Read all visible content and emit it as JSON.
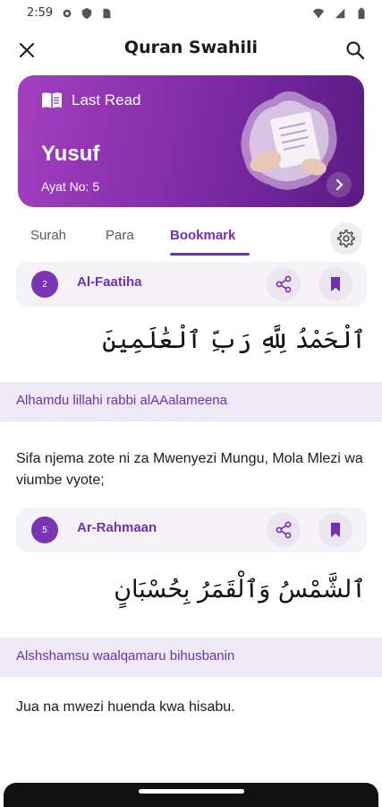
{
  "status_bar": {
    "time": "2:59"
  },
  "app_bar": {
    "title": "Quran Swahili"
  },
  "last_read": {
    "label": "Last Read",
    "surah": "Yusuf",
    "ayat": "Ayat No: 5"
  },
  "tabs": [
    {
      "label": "Surah",
      "active": false
    },
    {
      "label": "Para",
      "active": false
    },
    {
      "label": "Bookmark",
      "active": true
    }
  ],
  "bookmarks": [
    {
      "number": "2",
      "surah": "Al-Faatiha",
      "arabic": "ٱلْحَمْدُ لِلَّهِ رَبِّ ٱلْعَٰلَمِينَ",
      "transliteration": "Alhamdu lillahi rabbi alAAalameena",
      "translation": "Sifa njema zote ni za Mwenyezi Mungu, Mola Mlezi wa viumbe vyote;"
    },
    {
      "number": "5",
      "surah": "Ar-Rahmaan",
      "arabic": "ٱلشَّمْسُ وَٱلْقَمَرُ بِحُسْبَانٍ",
      "transliteration": "Alshshamsu waalqamaru bihusbanin",
      "translation": "Jua na mwezi huenda kwa hisabu."
    }
  ],
  "colors": {
    "accent": "#7230b5",
    "card_start": "#a23fc0",
    "card_end": "#5b1a82",
    "translit_bg": "#efe8f6"
  },
  "icons": [
    "close-icon",
    "search-icon",
    "book-icon",
    "chevron-right-icon",
    "gear-icon",
    "share-icon",
    "bookmark-icon"
  ]
}
